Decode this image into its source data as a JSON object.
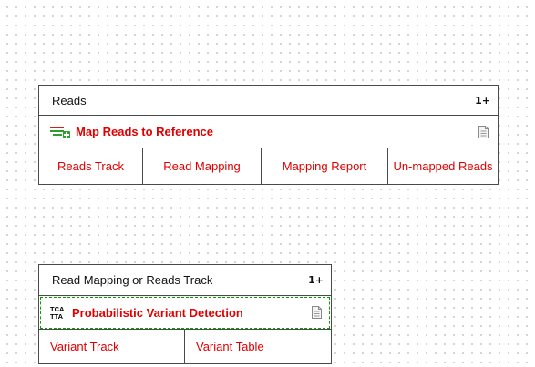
{
  "blocks": [
    {
      "input_label": "Reads",
      "input_multiplicity": "1+",
      "tool_label": "Map Reads to Reference",
      "tool_icon": "map-reads-icon",
      "outputs": [
        "Reads Track",
        "Read Mapping",
        "Mapping Report",
        "Un-mapped Reads"
      ]
    },
    {
      "input_label": "Read Mapping or Reads Track",
      "input_multiplicity": "1+",
      "tool_label": "Probabilistic Variant Detection",
      "tool_icon": "variant-detection-icon",
      "outputs": [
        "Variant Track",
        "Variant Table"
      ]
    }
  ],
  "colors": {
    "output_text": "#e00000",
    "tool_text": "#e00000",
    "selection_dash": "#00a000",
    "map_icon_green": "#2e9e2e",
    "map_icon_red": "#d02020"
  },
  "icons": [
    "map-reads-icon",
    "variant-detection-icon",
    "document-icon"
  ]
}
